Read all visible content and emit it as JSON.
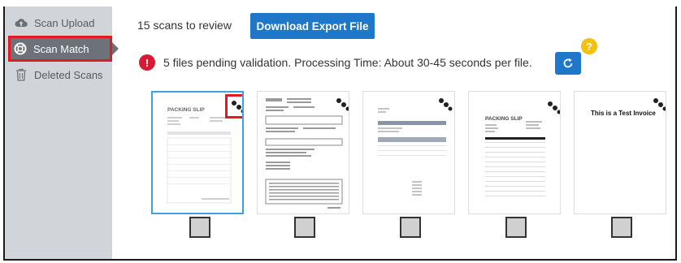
{
  "sidebar": {
    "items": [
      {
        "label": "Scan Upload",
        "icon": "cloud-upload-icon"
      },
      {
        "label": "Scan Match",
        "icon": "lifebuoy-icon",
        "active": true
      },
      {
        "label": "Deleted Scans",
        "icon": "trash-icon"
      }
    ]
  },
  "header": {
    "scan_count": "15 scans to review",
    "export_label": "Download Export File"
  },
  "status": {
    "pending_message": "5 files pending validation. Processing Time: About 30-45 seconds per file."
  },
  "thumbnails": [
    {
      "doc_title": "PACKING SLIP",
      "selected": true
    },
    {
      "doc_title": "",
      "selected": false
    },
    {
      "doc_title": "",
      "selected": false
    },
    {
      "doc_title": "PACKING SLIP",
      "selected": false
    },
    {
      "doc_title": "This is a Test Invoice",
      "selected": false
    }
  ],
  "colors": {
    "accent": "#1f77c9",
    "alert": "#d81b34",
    "help": "#f3c10d",
    "selection": "#3aa3e0",
    "highlight": "#e01b24"
  }
}
